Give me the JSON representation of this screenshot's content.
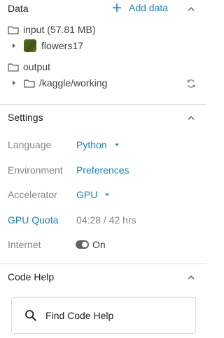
{
  "data_section": {
    "title": "Data",
    "add_data_label": "Add data",
    "input_folder_label": "input (57.81 MB)",
    "dataset_name": "flowers17",
    "output_folder_label": "output",
    "working_path": "/kaggle/working"
  },
  "settings_section": {
    "title": "Settings",
    "language": {
      "label": "Language",
      "value": "Python"
    },
    "environment": {
      "label": "Environment",
      "value": "Preferences"
    },
    "accelerator": {
      "label": "Accelerator",
      "value": "GPU"
    },
    "gpu_quota": {
      "label": "GPU Quota",
      "value": "04:28 / 42 hrs"
    },
    "internet": {
      "label": "Internet",
      "state": "On"
    }
  },
  "code_help_section": {
    "title": "Code Help",
    "search_label": "Find Code Help"
  },
  "colors": {
    "link": "#1784c7",
    "muted_text": "#80868b",
    "divider": "#dadce0",
    "dataset_thumb": "#4f6618"
  },
  "icons": [
    "plus-icon",
    "chevron-up-icon",
    "folder-icon",
    "caret-right-icon",
    "refresh-icon",
    "dropdown-arrow-icon",
    "toggle-switch",
    "search-icon"
  ]
}
